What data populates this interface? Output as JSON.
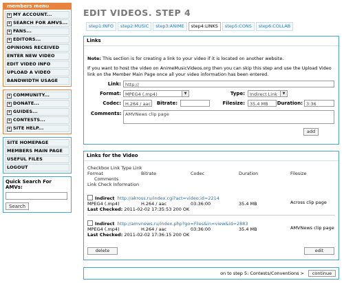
{
  "sidebar": {
    "header": "members menu",
    "group1": [
      {
        "label": "MY ACCOUNT...",
        "expand": true
      },
      {
        "label": "SEARCH FOR AMVS...",
        "expand": true
      },
      {
        "label": "FANS...",
        "expand": true
      },
      {
        "label": "EDITORS...",
        "expand": true
      },
      {
        "label": "OPINIONS RECEIVED",
        "expand": false
      },
      {
        "label": "ENTER NEW VIDEO",
        "expand": false
      },
      {
        "label": "EDIT VIDEO INFO",
        "expand": false
      },
      {
        "label": "UPLOAD A VIDEO",
        "expand": false
      },
      {
        "label": "BANDWIDTH USAGE",
        "expand": false
      }
    ],
    "group2": [
      {
        "label": "COMMUNITY...",
        "expand": true
      },
      {
        "label": "DONATE...",
        "expand": true
      },
      {
        "label": "GUIDES...",
        "expand": true
      },
      {
        "label": "CONTESTS...",
        "expand": true
      },
      {
        "label": "SITE HELP...",
        "expand": true
      }
    ],
    "group3": [
      {
        "label": "SITE HOMEPAGE"
      },
      {
        "label": "MEMBERS MAIN PAGE"
      },
      {
        "label": "USEFUL FILES"
      },
      {
        "label": "LOGOUT"
      }
    ],
    "quick_search": {
      "label": "Quick Search For AMVs:",
      "value": "",
      "button": "Search"
    }
  },
  "page_title": "EDIT VIDEOS. STEP 4",
  "tabs": [
    {
      "label": "step1:INFO",
      "active": false
    },
    {
      "label": "step2:MUSIC",
      "active": false
    },
    {
      "label": "step3:ANIME",
      "active": false
    },
    {
      "label": "step4:LINKS",
      "active": true
    },
    {
      "label": "step5:CONS",
      "active": false
    },
    {
      "label": "step6:COLLAB",
      "active": false
    }
  ],
  "links_panel": {
    "title": "Links",
    "note_label": "Note:",
    "note_text": "This section is for creating a link to your video if it is located on another website.",
    "info": "If you want to host the video on AnimeMusicVideos.org then you can skip this step and use the Upload Video link on the Member Main Page once all your video information has been entered.",
    "form": {
      "link_label": "Link:",
      "link_value": "http://",
      "format_label": "Format:",
      "format_value": "MPEG4 (.mp4)",
      "type_label": "Type:",
      "type_value": "Indirect Link",
      "codec_label": "Codec:",
      "codec_value": "H.264 / aac",
      "bitrate_label": "Bitrate:",
      "bitrate_value": "",
      "filesize_label": "Filesize:",
      "filesize_value": "35.4 MB",
      "duration_label": "Duration:",
      "duration_value": "3:36",
      "comments_label": "Comments:",
      "comments_value": "AMVNews clip page",
      "add_button": "add"
    }
  },
  "video_panel": {
    "title": "Links for the Video",
    "header_line1": "Checkbox Link Type Link",
    "header_cols": [
      "Format",
      "Bitrate",
      "Codec",
      "Duration",
      "Filesize"
    ],
    "header_line3": "Comments",
    "header_line4": "Link Check Information",
    "rows": [
      {
        "type": "Indirect",
        "url": "http://akross.ru/index.cgi?act=video;id=2214",
        "format": "MPEG4 (.mp4)",
        "codec": "H.264 / aac",
        "duration": "03:36:00",
        "filesize": "35.4 MB",
        "comments": "Across clip page",
        "last_checked_label": "Last Checked:",
        "last_checked": "2011-02-02 17:35:53 200 OK"
      },
      {
        "type": "Indirect",
        "url": "http://amvnews.ru/index.php?go=Files&in=view&id=2883",
        "format": "MPEG4 (.mp4)",
        "codec": "H.264 / aac",
        "duration": "03:36:00",
        "filesize": "35.4 MB",
        "comments": "AMVNews clip page",
        "last_checked_label": "Last Checked:",
        "last_checked": "2011-02-02 17:36:15 200 OK"
      }
    ],
    "delete_button": "delete",
    "edit_button": "edit"
  },
  "footer": {
    "text": "on to step 5: Contests/Conventions >",
    "button": "continue"
  },
  "colors": {
    "orange": "#e8823c",
    "blue": "#4aa3c8",
    "link": "#1f6fb8"
  }
}
